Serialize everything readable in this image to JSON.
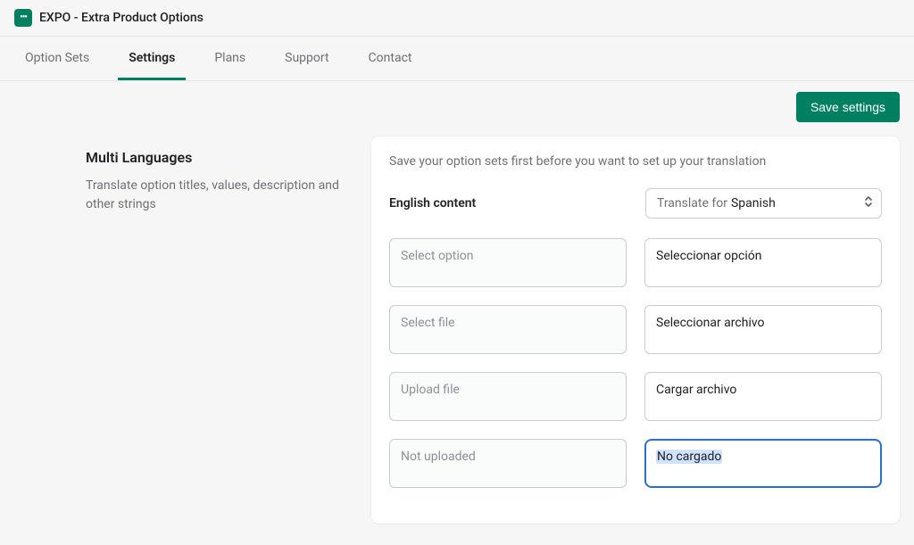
{
  "app": {
    "title": "EXPO - Extra Product Options"
  },
  "nav": {
    "items": [
      {
        "label": "Option Sets"
      },
      {
        "label": "Settings"
      },
      {
        "label": "Plans"
      },
      {
        "label": "Support"
      },
      {
        "label": "Contact"
      }
    ],
    "activeIndex": 1
  },
  "actions": {
    "save_label": "Save settings"
  },
  "section": {
    "title": "Multi Languages",
    "description": "Translate option titles, values, description and other strings"
  },
  "panel": {
    "hint": "Save your option sets first before you want to set up your translation",
    "header_label": "English content",
    "translate_prefix": "Translate for ",
    "translate_language": "Spanish"
  },
  "rows": [
    {
      "source": "Select option",
      "target": "Seleccionar opción"
    },
    {
      "source": "Select file",
      "target": "Seleccionar archivo"
    },
    {
      "source": "Upload file",
      "target": "Cargar archivo"
    },
    {
      "source": "Not uploaded",
      "target": "No cargado"
    }
  ],
  "focusedRowIndex": 3,
  "colors": {
    "accent": "#008060",
    "focus": "#2c6ecb"
  }
}
